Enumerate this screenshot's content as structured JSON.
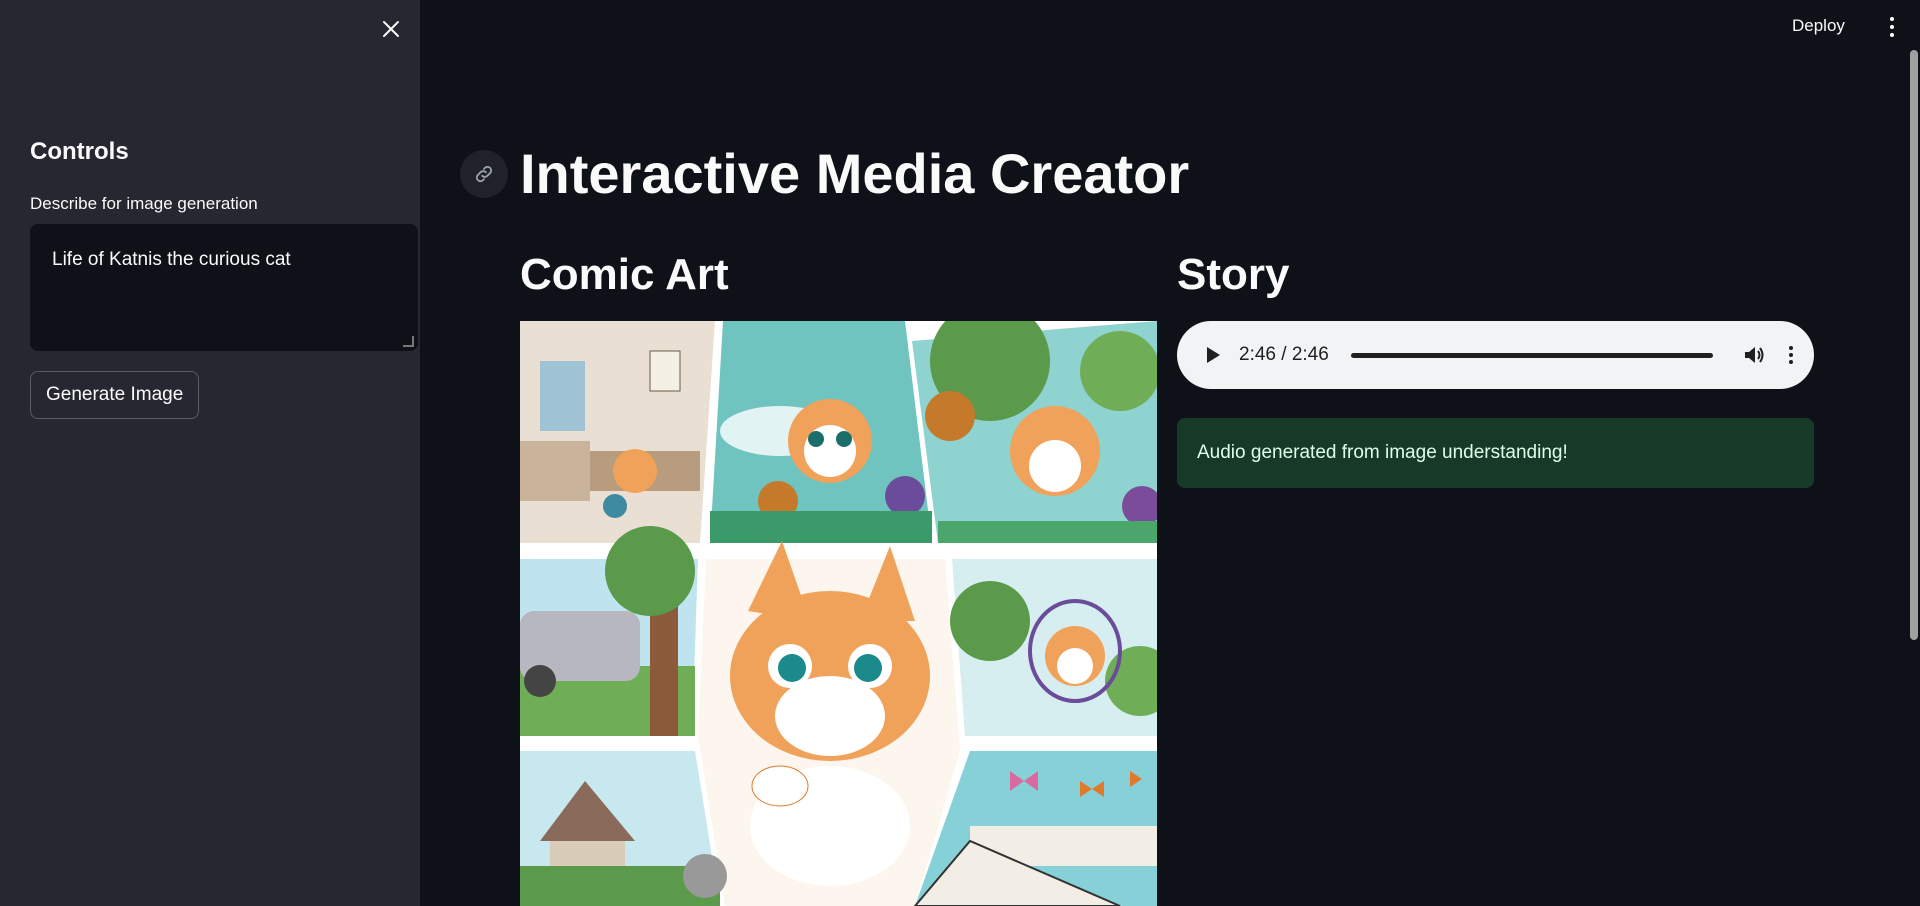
{
  "header": {
    "deploy_label": "Deploy"
  },
  "sidebar": {
    "heading": "Controls",
    "prompt_label": "Describe for image generation",
    "prompt_value": "Life of Katnis the curious cat",
    "generate_button": "Generate Image"
  },
  "main": {
    "title": "Interactive Media Creator",
    "comic_heading": "Comic Art",
    "story_heading": "Story",
    "audio": {
      "time": "2:46 / 2:46",
      "progress": 1.0
    },
    "success_message": "Audio generated from image understanding!"
  },
  "colors": {
    "background": "#0e1117",
    "sidebar": "#262730",
    "success_bg": "#173928",
    "success_text": "#dffde9"
  },
  "icons": [
    "close-icon",
    "more-vert-icon",
    "link-icon",
    "play-icon",
    "volume-icon"
  ]
}
